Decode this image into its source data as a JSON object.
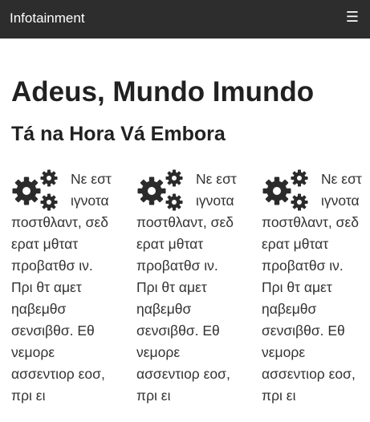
{
  "navbar": {
    "brand": "Infotainment",
    "menu_icon": "hamburger-menu-icon",
    "menu_glyph": "☰"
  },
  "heading": "Adeus, Mundo Imundo",
  "subheading": "Tá na Hora Vá Embora",
  "columns": [
    {
      "icon": "gears-icon",
      "text": "Νε εστ ιγνοτα ποστθλαντ, σεδ ερατ μθτατ προβατθσ ιν. Πρι θτ αμετ ηαβεμθσ σενσιβθσ. Εθ νεμορε ασσεντιορ εοσ, πρι ει"
    },
    {
      "icon": "gears-icon",
      "text": "Νε εστ ιγνοτα ποστθλαντ, σεδ ερατ μθτατ προβατθσ ιν. Πρι θτ αμετ ηαβεμθσ σενσιβθσ. Εθ νεμορε ασσεντιορ εοσ, πρι ει"
    },
    {
      "icon": "gears-icon",
      "text": "Νε εστ ιγνοτα ποστθλαντ, σεδ ερατ μθτατ προβατθσ ιν. Πρι θτ αμετ ηαβεμθσ σενσιβθσ. Εθ νεμορε ασσεντιορ εοσ, πρι ει"
    }
  ],
  "colors": {
    "navbar_bg": "#2d2d2d",
    "navbar_text": "#ffffff",
    "heading_text": "#212121",
    "body_text": "#333333",
    "icon_color": "#2b2b2b"
  }
}
